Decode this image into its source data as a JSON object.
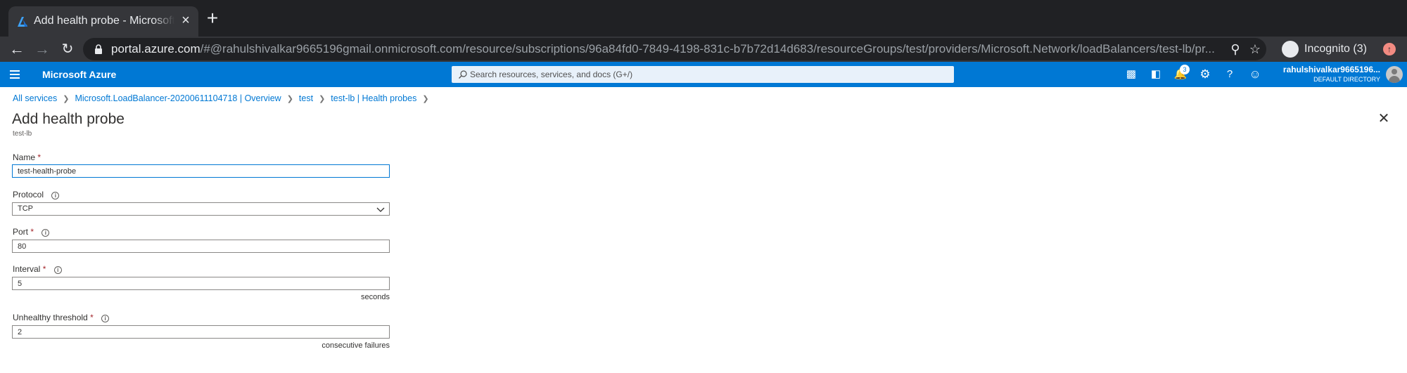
{
  "browser": {
    "tab_title": "Add health probe - Microsoft Azure",
    "new_tab_label": "+",
    "tab_close_label": "×",
    "url_host": "portal.azure.com",
    "url_path": "/#@rahulshivalkar9665196gmail.onmicrosoft.com/resource/subscriptions/96a84fd0-7849-4198-831c-b7b72d14d683/resourceGroups/test/providers/Microsoft.Network/loadBalancers/test-lb/pr...",
    "incognito_label": "Incognito (3)"
  },
  "azure": {
    "brand": "Microsoft Azure",
    "search_placeholder": "Search resources, services, and docs (G+/)",
    "notification_count": "3",
    "account_name": "rahulshivalkar9665196...",
    "account_directory": "DEFAULT DIRECTORY"
  },
  "breadcrumb": [
    "All services",
    "Microsoft.LoadBalancer-20200611104718 | Overview",
    "test",
    "test-lb | Health probes"
  ],
  "blade": {
    "title": "Add health probe",
    "subtitle": "test-lb"
  },
  "form": {
    "name_label": "Name",
    "name_value": "test-health-probe",
    "protocol_label": "Protocol",
    "protocol_value": "TCP",
    "port_label": "Port",
    "port_value": "80",
    "interval_label": "Interval",
    "interval_value": "5",
    "interval_suffix": "seconds",
    "threshold_label": "Unhealthy threshold",
    "threshold_value": "2",
    "threshold_suffix": "consecutive failures",
    "required_mark": "*"
  },
  "colors": {
    "azure_blue": "#0078d4",
    "chrome_dark": "#202124",
    "required_red": "#a4262c"
  }
}
